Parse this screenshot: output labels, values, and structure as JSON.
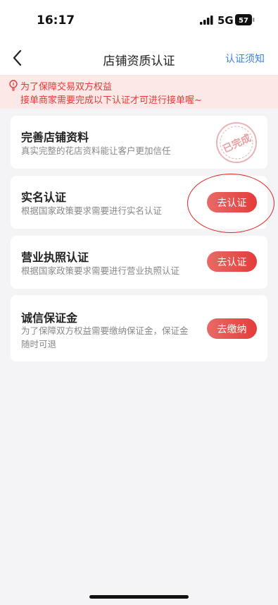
{
  "status_bar": {
    "time": "16:17",
    "network": "5G",
    "battery": "57"
  },
  "nav": {
    "title": "店铺资质认证",
    "notice_link": "认证须知"
  },
  "banner": {
    "line1": "为了保障交易双方权益",
    "line2": "接单商家需要完成以下认证才可进行接单喔~"
  },
  "cards": [
    {
      "title": "完善店铺资料",
      "desc": "真实完整的花店资料能让客户更加信任",
      "stamp": "已完成"
    },
    {
      "title": "实名认证",
      "desc": "根据国家政策要求需要进行实名认证",
      "button": "去认证"
    },
    {
      "title": "营业执照认证",
      "desc": "根据国家政策要求需要进行营业执照认证",
      "button": "去认证"
    },
    {
      "title": "诚信保证金",
      "desc_line1": "为了保障双方权益需要缴纳保证金，保证金",
      "desc_line2": "随时可退",
      "button": "去缴纳"
    }
  ],
  "colors": {
    "accent": "#e33d3a",
    "link": "#3b82e8",
    "banner_bg": "#fde8e8"
  },
  "icons": [
    "back-arrow-icon",
    "signal-icon",
    "battery-icon",
    "bulb-icon",
    "completed-stamp-icon"
  ]
}
